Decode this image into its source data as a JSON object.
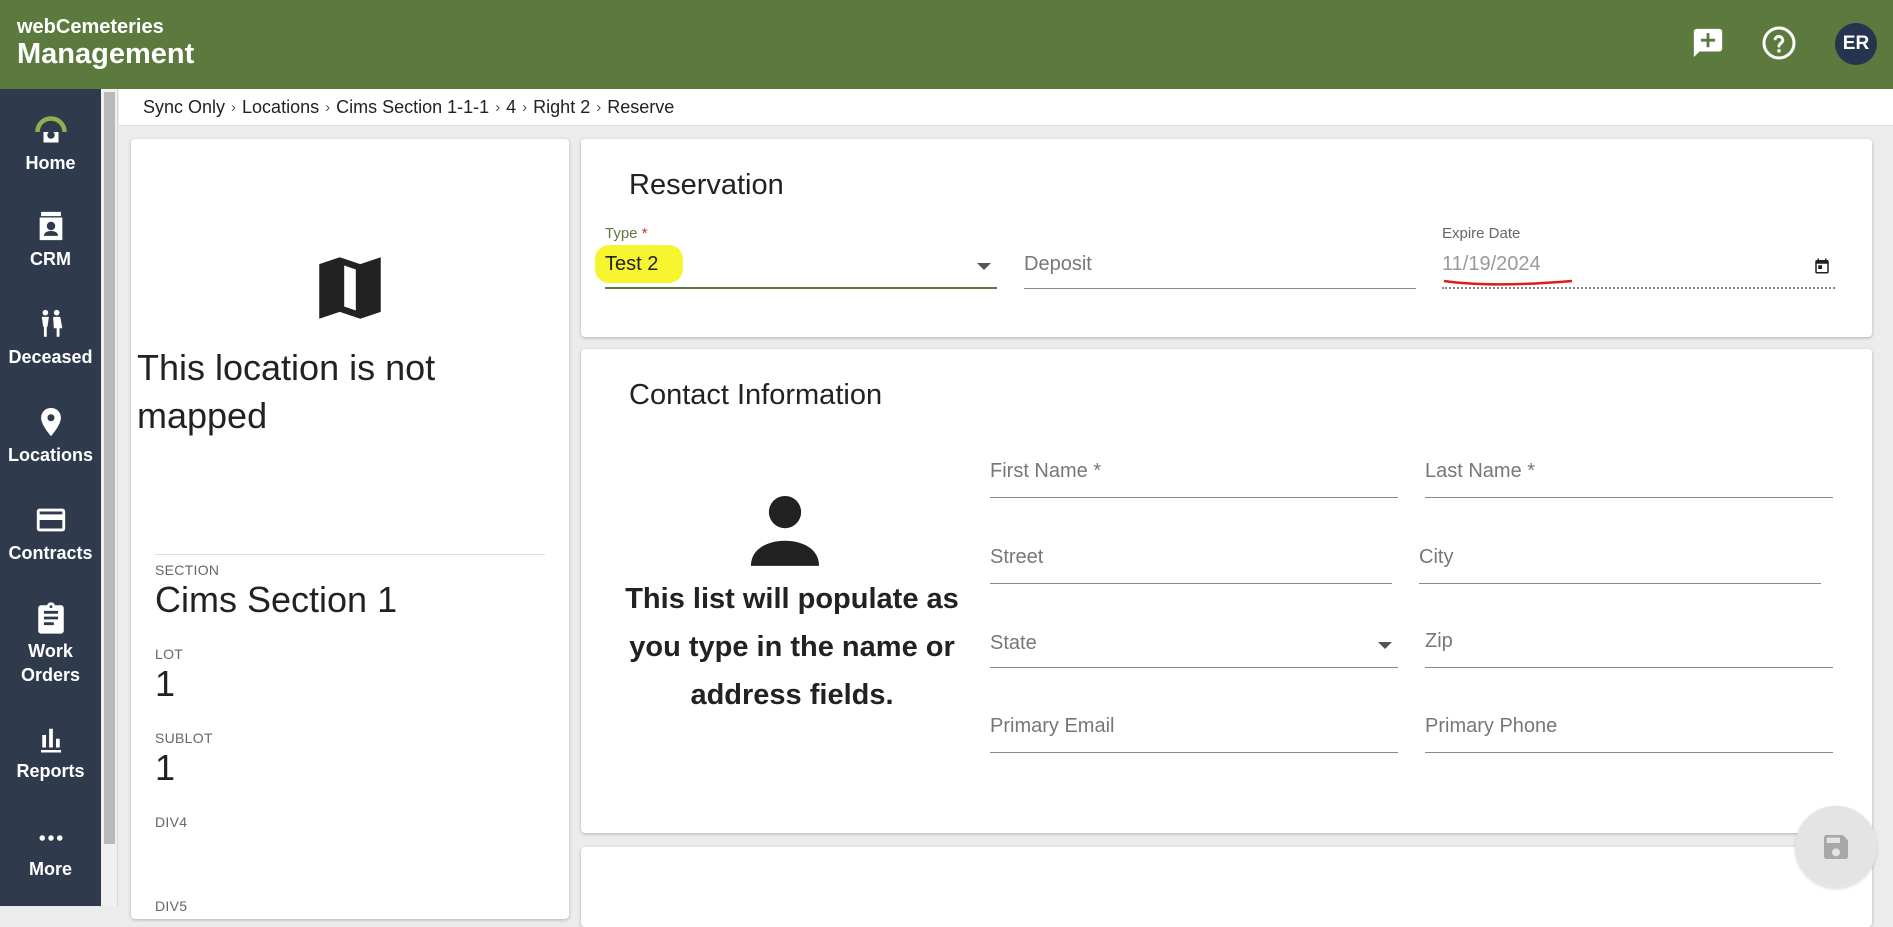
{
  "brand": {
    "small": "webCemeteries",
    "big": "Management"
  },
  "header": {
    "icons": [
      "feedback-add-icon",
      "help-circle-icon"
    ],
    "avatar_initials": "ER",
    "colors": {
      "bar": "#5c7a3e",
      "sidebar": "#2f3a4d",
      "avatar": "#25344f"
    }
  },
  "sidebar": {
    "items": [
      {
        "label": "Home",
        "icon": "home-gauge-icon"
      },
      {
        "label": "CRM",
        "icon": "contact-card-icon"
      },
      {
        "label": "Deceased",
        "icon": "people-icon"
      },
      {
        "label": "Locations",
        "icon": "map-pin-icon"
      },
      {
        "label": "Contracts",
        "icon": "credit-card-icon"
      },
      {
        "label": "Work Orders",
        "icon": "clipboard-icon"
      },
      {
        "label": "Reports",
        "icon": "bar-chart-icon"
      },
      {
        "label": "More",
        "icon": "more-dots-icon"
      }
    ]
  },
  "breadcrumb": [
    "Sync Only",
    "Locations",
    "Cims Section 1-1-1",
    "4",
    "Right 2",
    "Reserve"
  ],
  "location": {
    "not_mapped": "This location is not mapped",
    "section_label": "SECTION",
    "section_value": "Cims Section 1",
    "lot_label": "LOT",
    "lot_value": "1",
    "sublot_label": "SUBLOT",
    "sublot_value": "1",
    "div4_label": "DIV4",
    "div5_label": "DIV5"
  },
  "reservation": {
    "title": "Reservation",
    "type_label": "Type",
    "type_required": "*",
    "type_value": "Test 2",
    "deposit_placeholder": "Deposit",
    "expire_label": "Expire Date",
    "expire_value": "11/19/2024"
  },
  "contact": {
    "title": "Contact Information",
    "hint": "This list will populate as you type in the name or address fields.",
    "first_name": "First Name *",
    "last_name": "Last Name *",
    "street": "Street",
    "city": "City",
    "state": "State",
    "zip": "Zip",
    "email": "Primary Email",
    "phone": "Primary Phone"
  }
}
